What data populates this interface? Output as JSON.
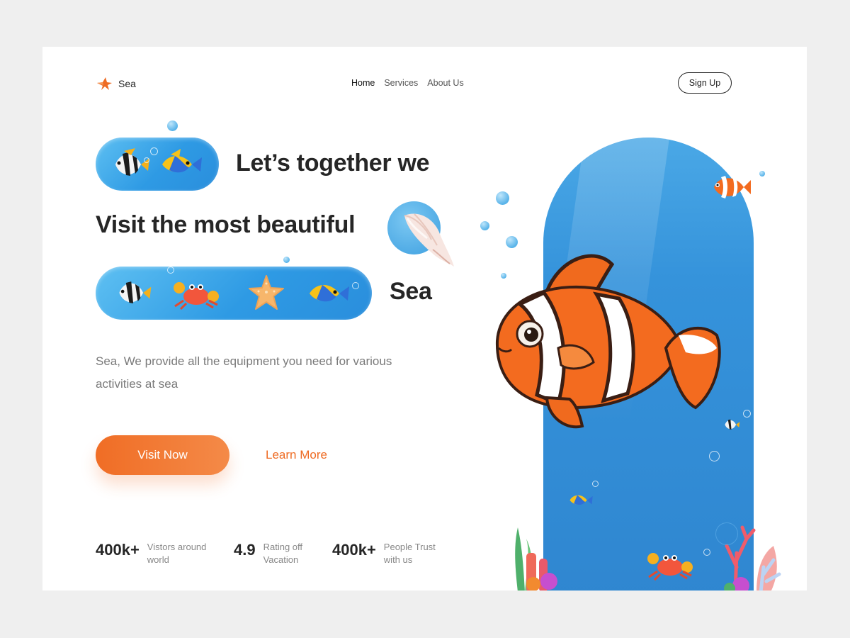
{
  "header": {
    "brand": "Sea",
    "nav": [
      {
        "label": "Home",
        "active": true
      },
      {
        "label": "Services",
        "active": false
      },
      {
        "label": "About Us",
        "active": false
      }
    ],
    "signup_label": "Sign Up"
  },
  "hero": {
    "line1": "Let’s together we",
    "line2": "Visit the most beautiful",
    "line3": "Sea",
    "description": "Sea, We provide all the equipment you need for various activities at sea",
    "primary_cta": "Visit Now",
    "secondary_cta": "Learn More"
  },
  "stats": [
    {
      "value": "400k+",
      "label": "Vistors around world"
    },
    {
      "value": "4.9",
      "label": "Rating off Vacation"
    },
    {
      "value": "400k+",
      "label": "People Trust with us"
    }
  ],
  "colors": {
    "accent": "#ee6b23",
    "ocean": "#2f8ed8",
    "page_bg": "#efefef",
    "card_bg": "#ffffff"
  },
  "icons": [
    "starfish-logo-icon",
    "angelfish-icon",
    "yellow-tang-icon",
    "crab-icon",
    "starfish-icon",
    "seashell-icon",
    "clownfish-icon",
    "coral-icon"
  ]
}
